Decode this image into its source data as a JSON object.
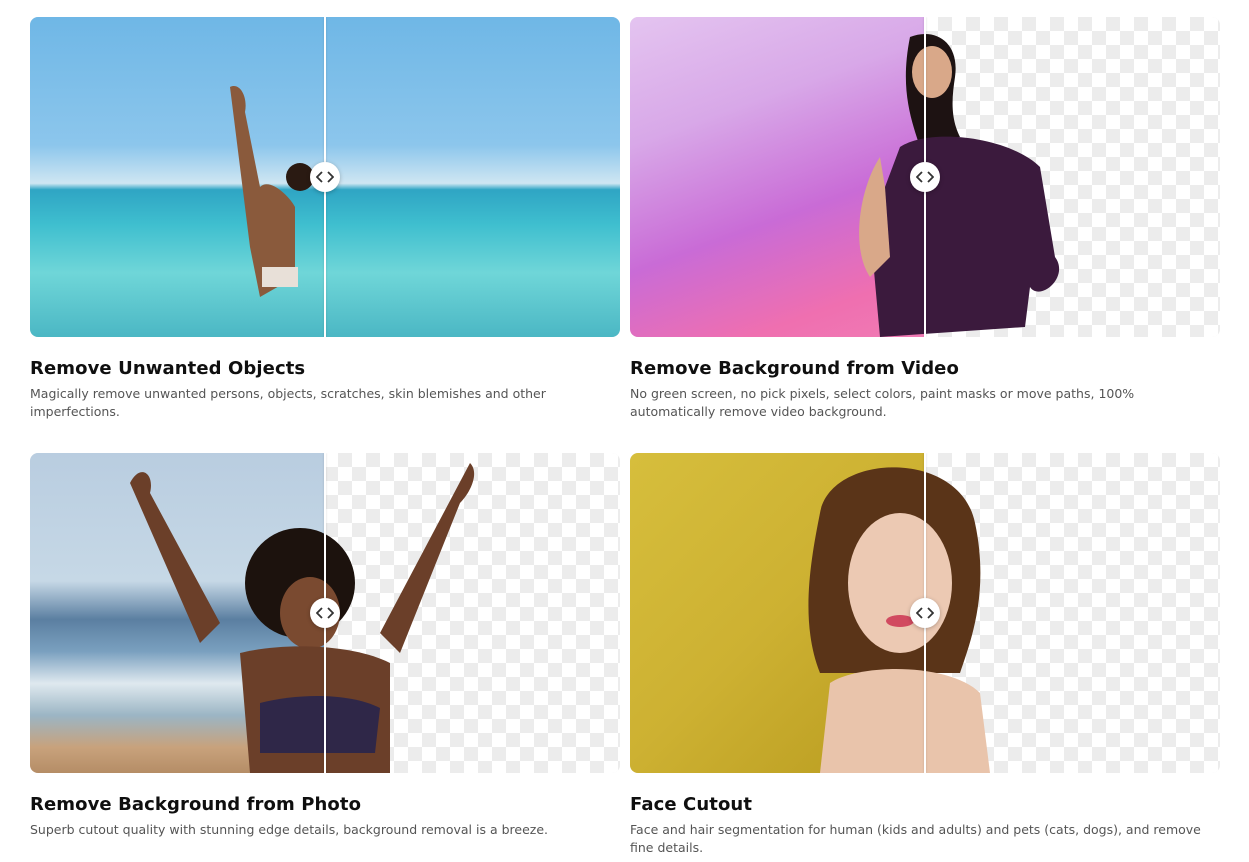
{
  "features": [
    {
      "title": "Remove Unwanted Objects",
      "description": "Magically remove unwanted persons, objects, scratches, skin blemishes and other imperfections."
    },
    {
      "title": "Remove Background from Video",
      "description": "No green screen, no pick pixels, select colors, paint masks or move paths, 100% automatically remove video background."
    },
    {
      "title": "Remove Background from Photo",
      "description": "Superb cutout quality with stunning edge details, background removal is a breeze."
    },
    {
      "title": "Face Cutout",
      "description": "Face and hair segmentation for human (kids and adults) and pets (cats, dogs), and remove fine details."
    }
  ],
  "icons": {
    "slider_handle": "chevron-left-right-icon"
  }
}
